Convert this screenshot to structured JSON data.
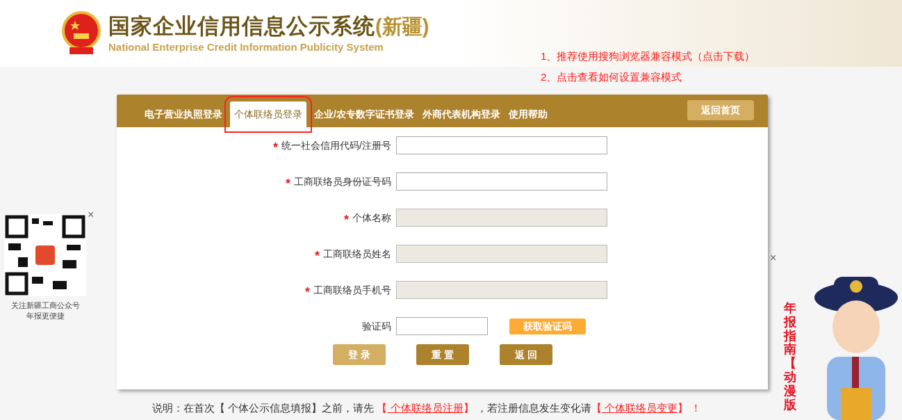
{
  "header": {
    "title": "国家企业信用信息公示系统",
    "region": "(新疆)",
    "subtitle": "National Enterprise Credit Information Publicity System"
  },
  "notices": [
    "1、推荐使用搜狗浏览器兼容模式（点击下载）",
    "2、点击查看如何设置兼容模式"
  ],
  "tabs": [
    {
      "label": "电子营业执照登录",
      "selected": false
    },
    {
      "label": "个体联络员登录",
      "selected": true
    },
    {
      "label": "企业/农专数字证书登录",
      "selected": false
    },
    {
      "label": "外商代表机构登录",
      "selected": false
    },
    {
      "label": "使用帮助",
      "selected": false
    }
  ],
  "home_button": "返回首页",
  "fields": [
    {
      "marker": "*",
      "label": "统一社会信用代码/注册号",
      "disabled": false
    },
    {
      "marker": "*",
      "label": "工商联络员身份证号码",
      "disabled": false
    },
    {
      "marker": "*",
      "label": "个体名称",
      "disabled": true
    },
    {
      "marker": "*",
      "label": "工商联络员姓名",
      "disabled": true
    },
    {
      "marker": "*",
      "label": "工商联络员手机号",
      "disabled": true
    }
  ],
  "captcha": {
    "label": "验证码",
    "button": "获取验证码"
  },
  "actions": [
    {
      "label": "登 录",
      "kind": "primary"
    },
    {
      "label": "重 置",
      "kind": "secondary"
    },
    {
      "label": "返 回",
      "kind": "secondary"
    }
  ],
  "footer": {
    "parts": [
      {
        "text": "说明：在首次【 个体公示信息填报】之前，请先 ",
        "kind": "text"
      },
      {
        "text": "【",
        "kind": "bracket"
      },
      {
        "text": " 个体联络员注册",
        "kind": "link"
      },
      {
        "text": "】",
        "kind": "bracket"
      },
      {
        "text": " ，若注册信息发生变化请",
        "kind": "text"
      },
      {
        "text": "【",
        "kind": "bracket"
      },
      {
        "text": " 个体联络员变更",
        "kind": "link"
      },
      {
        "text": "】",
        "kind": "bracket"
      },
      {
        "text": " ！",
        "kind": "bracket"
      }
    ]
  },
  "qr": {
    "caption": [
      "关注新疆工商公众号",
      "年报更便捷"
    ],
    "close": "×"
  },
  "guide": {
    "text": "年报指南【动漫版",
    "close": "×"
  }
}
